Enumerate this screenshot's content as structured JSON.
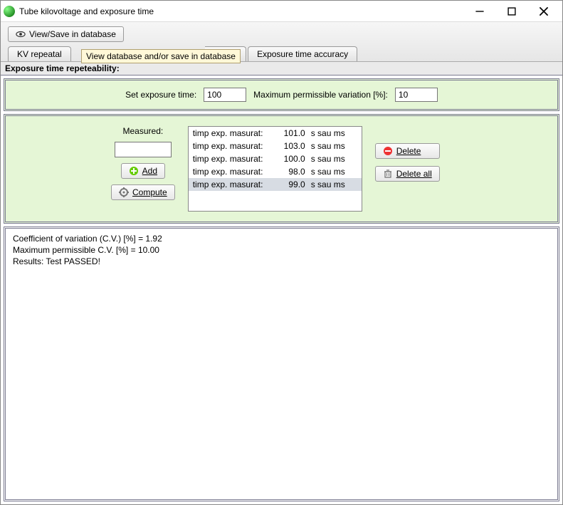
{
  "window": {
    "title": "Tube kilovoltage and exposure time"
  },
  "toolbar": {
    "view_save_label": "View/Save in database",
    "tooltip_text": "View database and/or save in database"
  },
  "tabs": {
    "t1": "KV repeatal",
    "t3_partial": "ccuracy",
    "t4": "Exposure time accuracy"
  },
  "section_label": "Exposure time repeteability:",
  "inputs": {
    "set_exposure_label": "Set exposure time:",
    "set_exposure_value": "100",
    "max_var_label": "Maximum permissible variation [%]:",
    "max_var_value": "10"
  },
  "measure": {
    "measured_label": "Measured:",
    "measured_value": "",
    "add_label": "Add",
    "compute_label": "Compute",
    "delete_label": "Delete",
    "delete_all_label": "Delete all",
    "rows": [
      {
        "label": "timp exp. masurat:",
        "value": "101.0",
        "unit": "s sau ms"
      },
      {
        "label": "timp exp. masurat:",
        "value": "103.0",
        "unit": "s sau ms"
      },
      {
        "label": "timp exp. masurat:",
        "value": "100.0",
        "unit": "s sau ms"
      },
      {
        "label": "timp exp. masurat:",
        "value": "98.0",
        "unit": "s sau ms"
      },
      {
        "label": "timp exp. masurat:",
        "value": "99.0",
        "unit": "s sau ms"
      }
    ]
  },
  "results": {
    "line1": "Coefficient of variation (C.V.) [%] = 1.92",
    "line2": "Maximum permissible C.V. [%] = 10.00",
    "line3": "Results:  Test PASSED!"
  }
}
